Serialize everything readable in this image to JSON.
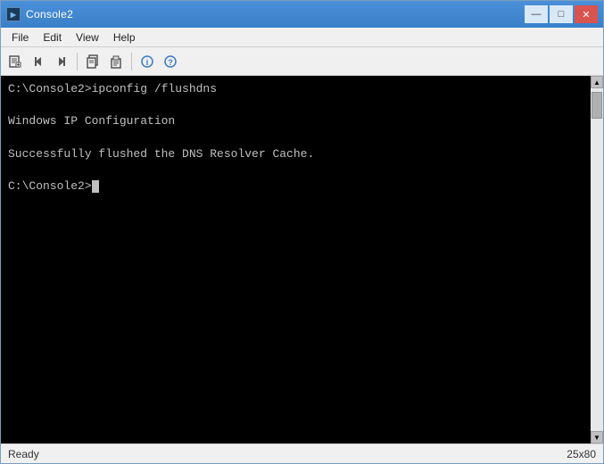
{
  "window": {
    "title": "Console2",
    "app_icon_label": "C2"
  },
  "titlebar_controls": {
    "minimize": "—",
    "maximize": "□",
    "close": "✕"
  },
  "menubar": {
    "items": [
      {
        "label": "File"
      },
      {
        "label": "Edit"
      },
      {
        "label": "View"
      },
      {
        "label": "Help"
      }
    ]
  },
  "toolbar": {
    "buttons": [
      {
        "icon": "📋",
        "name": "new-tab"
      },
      {
        "icon": "◀",
        "name": "prev"
      },
      {
        "icon": "▶",
        "name": "next"
      },
      {
        "sep": true
      },
      {
        "icon": "📋",
        "name": "copy"
      },
      {
        "icon": "📄",
        "name": "paste"
      },
      {
        "sep": true
      },
      {
        "icon": "ℹ",
        "name": "info"
      },
      {
        "icon": "?",
        "name": "help"
      }
    ]
  },
  "terminal": {
    "lines": [
      "C:\\Console2>ipconfig /flushdns",
      "",
      "Windows IP Configuration",
      "",
      "Successfully flushed the DNS Resolver Cache.",
      "",
      "C:\\Console2>"
    ],
    "prompt_line": "C:\\Console2>"
  },
  "statusbar": {
    "status": "Ready",
    "dimensions": "25x80"
  }
}
